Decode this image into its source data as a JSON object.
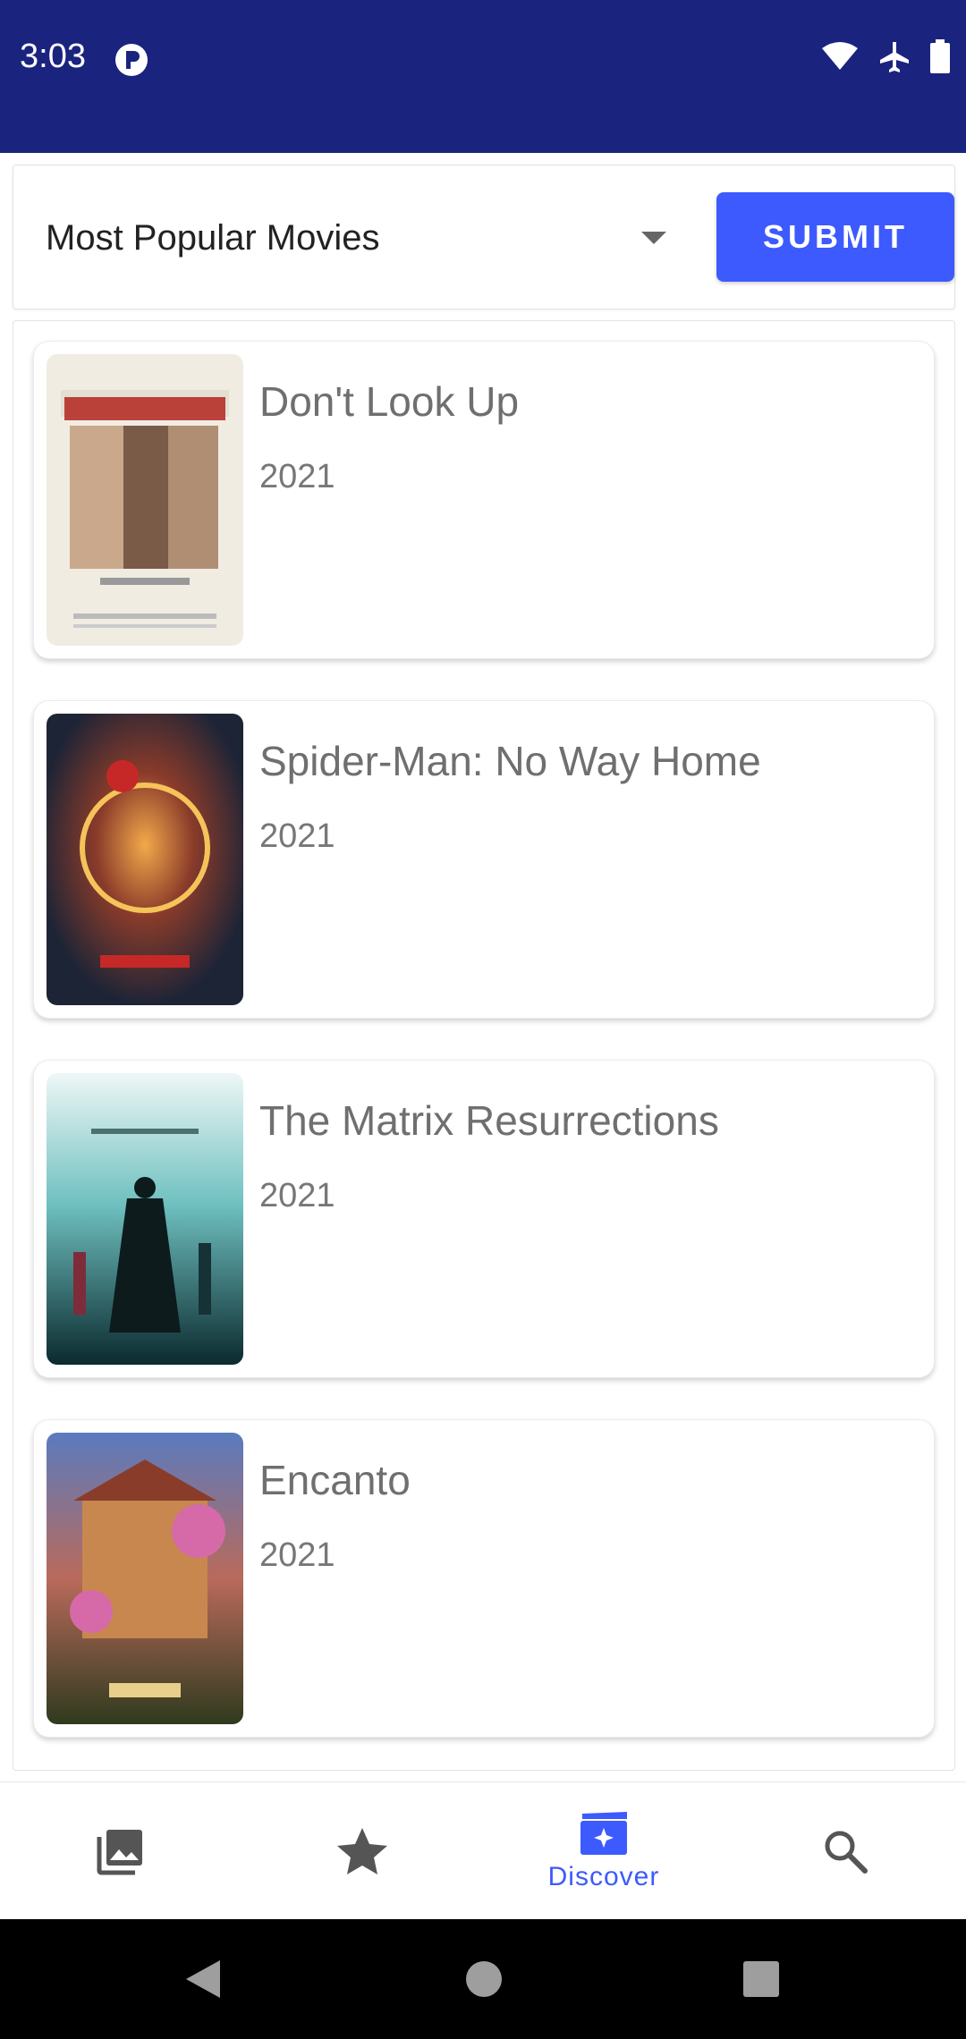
{
  "status_bar": {
    "time": "3:03",
    "icons": [
      "app-notification-icon",
      "wifi-icon",
      "airplane-mode-icon",
      "battery-icon"
    ],
    "background": "#1a237e"
  },
  "selector": {
    "selected_value": "Most Popular Movies",
    "submit_label": "SUBMIT",
    "accent": "#3d5afe"
  },
  "movies": [
    {
      "title": "Don't Look Up",
      "year": "2021",
      "poster": "dont-look-up-poster"
    },
    {
      "title": "Spider-Man: No Way Home",
      "year": "2021",
      "poster": "spider-man-poster"
    },
    {
      "title": "The Matrix Resurrections",
      "year": "2021",
      "poster": "matrix-poster"
    },
    {
      "title": "Encanto",
      "year": "2021",
      "poster": "encanto-poster"
    }
  ],
  "bottom_nav": {
    "items": [
      {
        "icon": "gallery-icon",
        "label": ""
      },
      {
        "icon": "star-icon",
        "label": ""
      },
      {
        "icon": "discover-icon",
        "label": "Discover",
        "active": true
      },
      {
        "icon": "search-icon",
        "label": ""
      }
    ]
  },
  "system_nav": {
    "icons": [
      "back-icon",
      "home-icon",
      "recents-icon"
    ]
  }
}
